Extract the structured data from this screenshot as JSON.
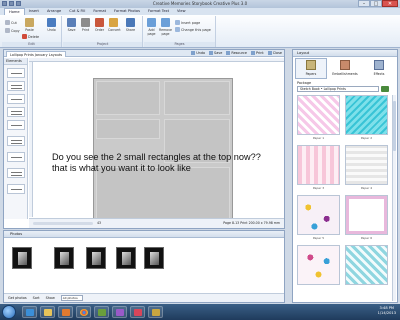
{
  "window": {
    "title": "Creative Memories Storybook Creative Plus 3.0"
  },
  "ribbon_tabs": [
    "Home",
    "Insert",
    "Arrange",
    "Cut & Fill",
    "Format",
    "Format Photos",
    "Format Text",
    "View"
  ],
  "ribbon": {
    "groups": [
      {
        "label": "Edit",
        "buttons": [
          "Cut",
          "Paste",
          "Copy",
          "Delete",
          "Undo"
        ]
      },
      {
        "label": "Project",
        "buttons": [
          "Save",
          "Print",
          "Order",
          "Convert",
          "Share"
        ]
      },
      {
        "label": "Pages",
        "buttons": [
          "Add page",
          "Remove page",
          "Insert page",
          "Change this page"
        ]
      }
    ]
  },
  "document": {
    "tab_title": "Lollipop Prints January Layouts",
    "tools": [
      "Undo",
      "Save",
      "Resource",
      "Print",
      "Close"
    ],
    "elements_title": "Elements",
    "overlay_text": "Do you see the 2 small rectangles at the top now??  that is what you want it to look like",
    "zoom_value": "43",
    "page_info": "Page 8-13  Print 200.00 x 79.98 mm"
  },
  "photos_panel": {
    "title": "Photos",
    "get_photos_label": "Get photos",
    "sort_label": "Sort",
    "show_label": "Show",
    "show_value": "All photos"
  },
  "side_panel": {
    "title": "Layout",
    "tabs": [
      "Papers",
      "Embellishments",
      "Effects"
    ],
    "package_label": "Package",
    "package_value": "Sketch Book • Lollipop Prints",
    "papers": [
      "Paper 1",
      "Paper 2",
      "Paper 3",
      "Paper 4",
      "Paper 5",
      "Paper 6",
      "",
      ""
    ]
  },
  "taskbar": {
    "time": "3:48 PM",
    "date": "1/14/2013"
  }
}
